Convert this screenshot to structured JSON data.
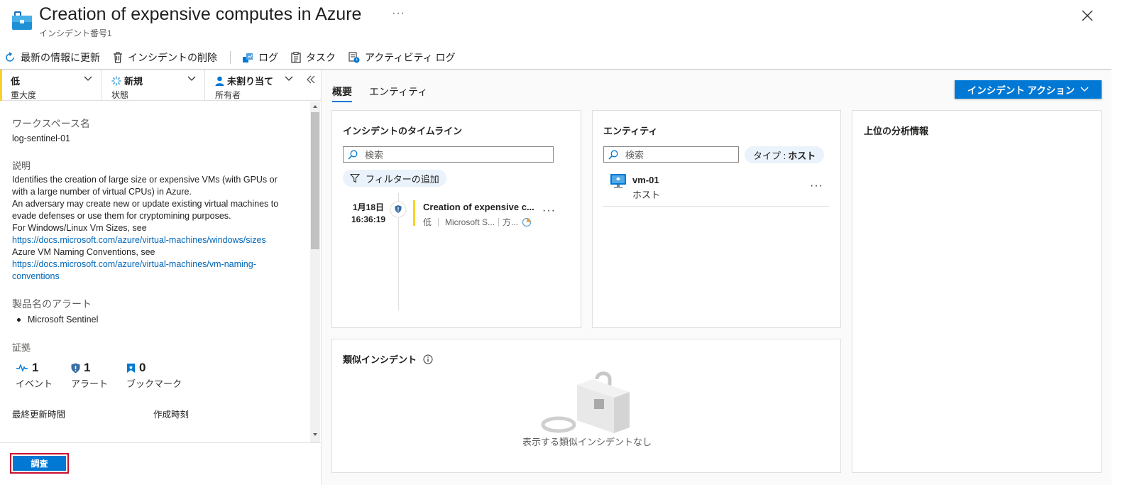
{
  "header": {
    "title": "Creation of expensive computes in Azure",
    "subtitle": "インシデント番号1",
    "more": "···"
  },
  "toolbar": {
    "refresh": "最新の情報に更新",
    "delete": "インシデントの削除",
    "logs": "ログ",
    "tasks": "タスク",
    "activity_log": "アクティビティ ログ"
  },
  "selectors": {
    "severity": {
      "value": "低",
      "label": "重大度"
    },
    "status": {
      "value": "新規",
      "label": "状態"
    },
    "owner": {
      "value": "未割り当て",
      "label": "所有者"
    }
  },
  "details": {
    "workspace_label": "ワークスペース名",
    "workspace_value": "log-sentinel-01",
    "description_label": "説明",
    "description_lines": [
      "Identifies the creation of large size or expensive VMs (with GPUs or",
      "with a large number of virtual CPUs) in Azure.",
      "An adversary may create new or update existing virtual machines to",
      "evade defenses or use them for cryptomining purposes.",
      "For Windows/Linux Vm Sizes, see"
    ],
    "link1": "https://docs.microsoft.com/azure/virtual-machines/windows/sizes",
    "naming_text": "Azure VM Naming Conventions, see",
    "link2_line1": "https://docs.microsoft.com/azure/virtual-machines/vm-naming-",
    "link2_line2": "conventions",
    "product_label": "製品名のアラート",
    "product_item": "Microsoft Sentinel",
    "evidence_label": "証拠",
    "evidence": [
      {
        "count": "1",
        "caption": "イベント"
      },
      {
        "count": "1",
        "caption": "アラート"
      },
      {
        "count": "0",
        "caption": "ブックマーク"
      }
    ],
    "last_updated_label": "最終更新時間",
    "created_label": "作成時刻"
  },
  "investigate_label": "調査",
  "tabs": {
    "overview": "概要",
    "entities": "エンティティ"
  },
  "incident_action": "インシデント アクション",
  "timeline": {
    "title": "インシデントのタイムライン",
    "search_placeholder": "検索",
    "filter": "フィルターの追加",
    "date": "1月18日",
    "time": "16:36:19",
    "item_title": "Creation of expensive c...",
    "item_severity": "低",
    "item_source": "Microsoft S...",
    "item_tactic": "方..."
  },
  "entities": {
    "title": "エンティティ",
    "search_placeholder": "検索",
    "type_pill_label": "タイプ : ",
    "type_pill_value": "ホスト",
    "item_name": "vm-01",
    "item_type": "ホスト"
  },
  "insights": {
    "title": "上位の分析情報"
  },
  "similar": {
    "title": "類似インシデント",
    "empty": "表示する類似インシデントなし"
  },
  "colors": {
    "accent": "#0078d4",
    "severity_low": "#f8d22a",
    "investigate_border": "#c8102e"
  }
}
